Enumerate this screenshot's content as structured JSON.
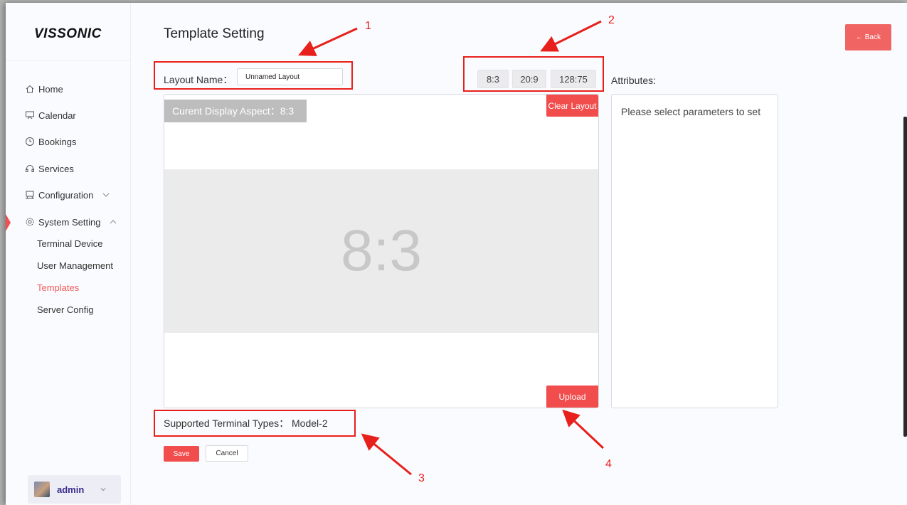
{
  "app": {
    "logo": "VISSONIC"
  },
  "sidebar": {
    "nav": [
      {
        "label": "Home",
        "icon": "home-icon"
      },
      {
        "label": "Calendar",
        "icon": "presentation-icon"
      },
      {
        "label": "Bookings",
        "icon": "clock-icon"
      },
      {
        "label": "Services",
        "icon": "headset-icon"
      },
      {
        "label": "Configuration",
        "icon": "monitor-icon",
        "expandable": true,
        "expanded": false
      },
      {
        "label": "System Setting",
        "icon": "gear-icon",
        "expandable": true,
        "expanded": true
      }
    ],
    "sub_items": [
      {
        "label": "Terminal Device",
        "active": false
      },
      {
        "label": "User Management",
        "active": false
      },
      {
        "label": "Templates",
        "active": true
      },
      {
        "label": "Server Config",
        "active": false
      }
    ],
    "user": {
      "name": "admin"
    }
  },
  "header": {
    "title": "Template Setting",
    "back_label": "← Back"
  },
  "layout": {
    "name_label": "Layout Name：",
    "name_value": "Unnamed Layout"
  },
  "aspects": [
    "8:3",
    "20:9",
    "128:75"
  ],
  "canvas": {
    "current_aspect_label": "Curent Display Aspect：8:3",
    "preview_text": "8:3",
    "clear_label": "Clear Layout",
    "upload_label": "Upload"
  },
  "attributes": {
    "label": "Attributes:",
    "message": "Please select parameters to set"
  },
  "terminal": {
    "text": "Supported Terminal Types： Model-2"
  },
  "actions": {
    "save": "Save",
    "cancel": "Cancel"
  },
  "annotations": [
    "1",
    "2",
    "3",
    "4"
  ],
  "colors": {
    "accent": "#f14d4d",
    "annotation": "#e8201c",
    "active_nav": "#f15a5a"
  }
}
